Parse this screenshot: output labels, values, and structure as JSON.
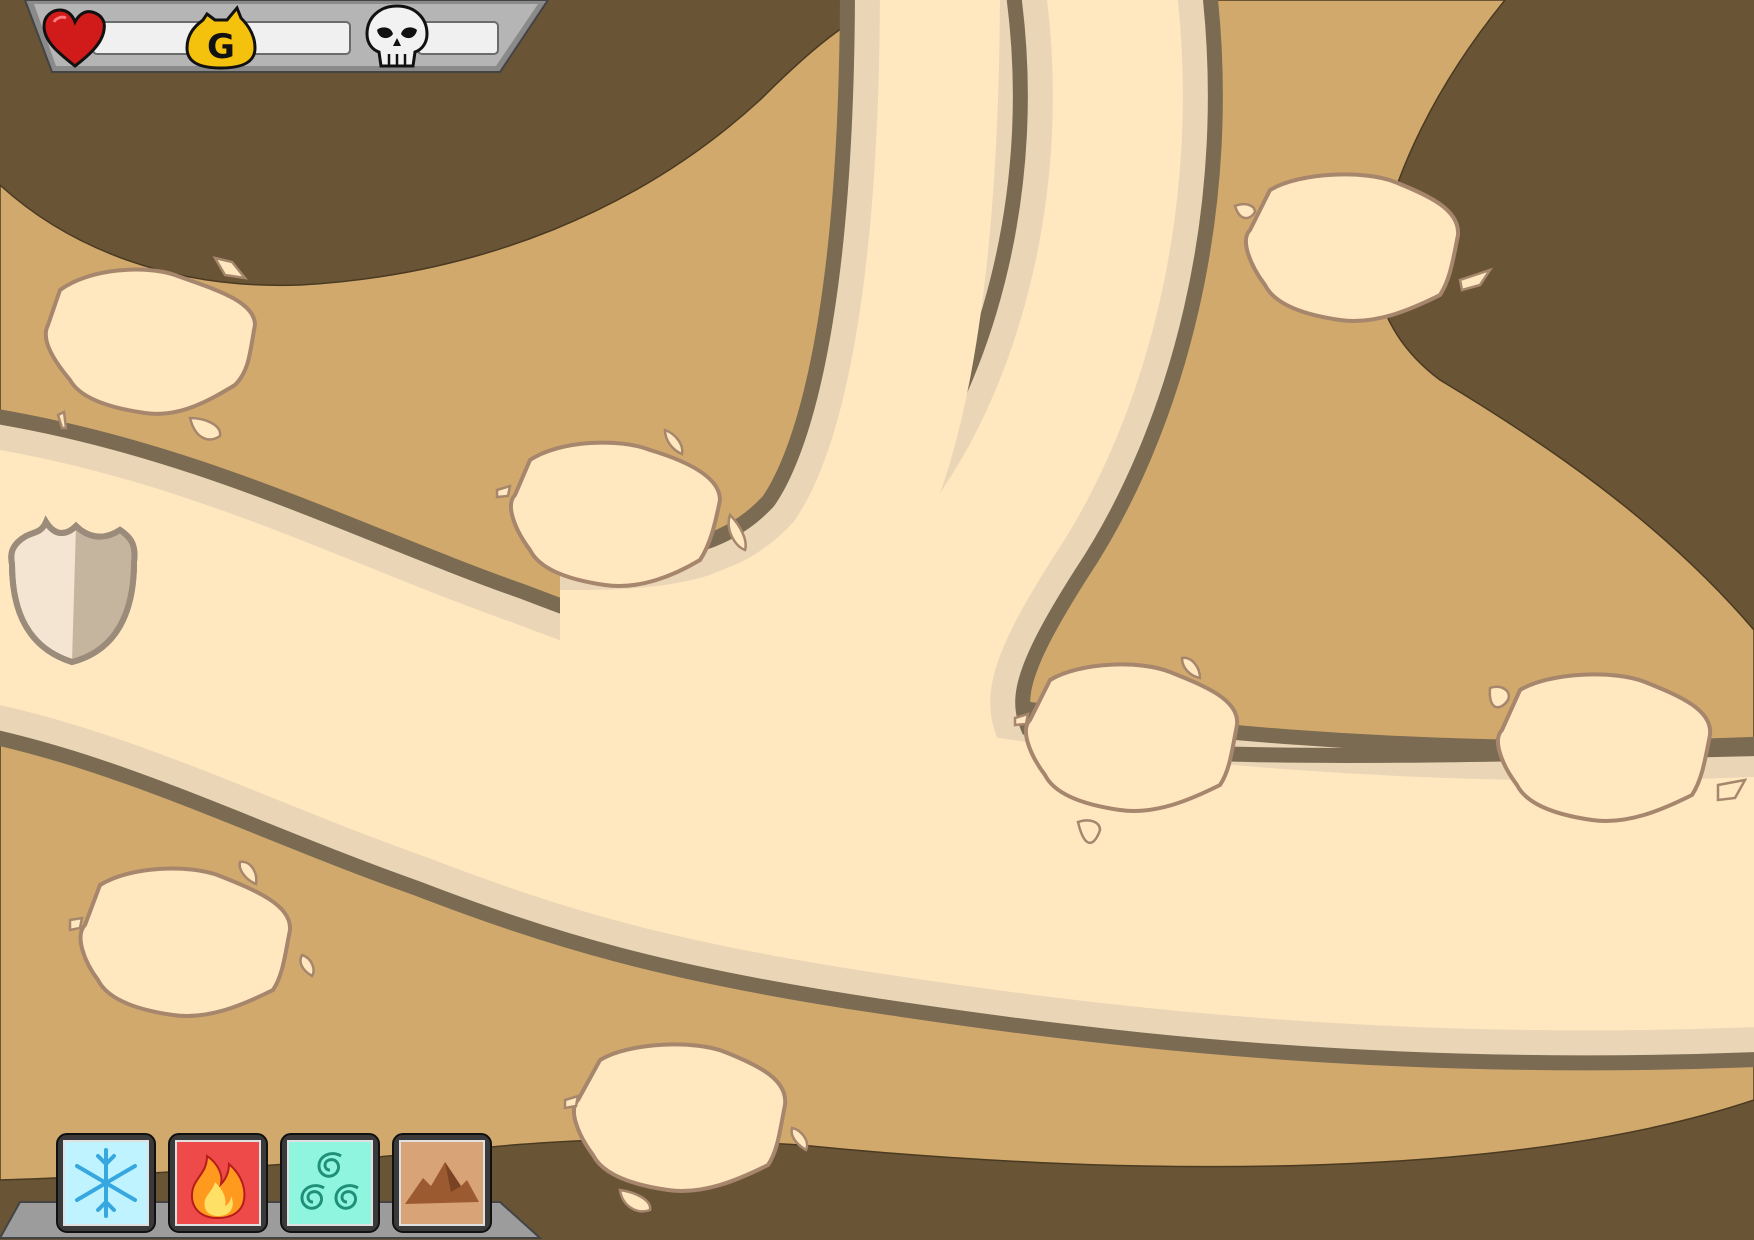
{
  "hud": {
    "lives": {
      "icon": "heart-icon",
      "value": "",
      "color": "#d11a1a"
    },
    "gold": {
      "icon": "gold-bag-icon",
      "value": "",
      "color": "#f4c20d",
      "glyph": "G"
    },
    "kills": {
      "icon": "skull-icon",
      "value": "",
      "color": "#f2f2f2"
    }
  },
  "towers": [
    {
      "id": "ice",
      "icon": "snowflake-icon",
      "color": "#bff3ff"
    },
    {
      "id": "fire",
      "icon": "flame-icon",
      "color": "#ef4a4a"
    },
    {
      "id": "wind",
      "icon": "spiral-icon",
      "color": "#8ff5df"
    },
    {
      "id": "earth",
      "icon": "mountain-icon",
      "color": "#d9a378"
    }
  ],
  "map": {
    "ground_color": "#d2a96c",
    "cliff_color": "#6a5436",
    "road_color": "#ffe7bf",
    "base_icon": "shield-icon"
  }
}
